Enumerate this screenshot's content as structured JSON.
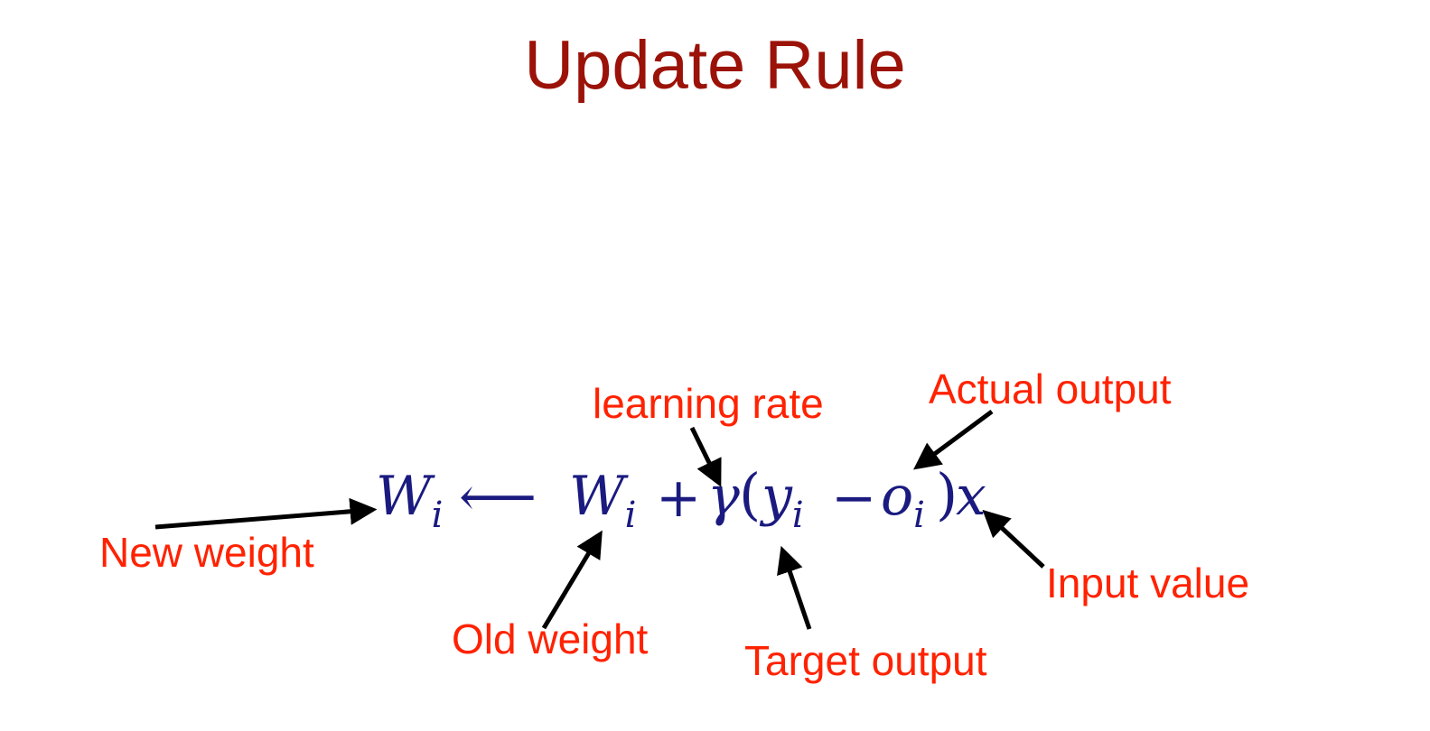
{
  "title": "Update Rule",
  "equation": {
    "lhs_symbol": "W",
    "lhs_sub": "i",
    "arrow": "⟵",
    "rhs_symbol": "W",
    "rhs_sub": "i",
    "plus": "+",
    "gamma": "γ",
    "open_paren": "(",
    "y_symbol": "y",
    "y_sub": "i",
    "minus": "−",
    "o_symbol": "o",
    "o_sub": "i",
    "close_paren": ")",
    "x_symbol": "x"
  },
  "labels": {
    "new_weight": "New weight",
    "old_weight": "Old weight",
    "learning_rate": "learning rate",
    "target_output": "Target output",
    "actual_output": "Actual output",
    "input_value": "Input value"
  },
  "colors": {
    "title": "#9b1208",
    "label": "#ff2200",
    "equation": "#1a1a80",
    "arrow": "#000000"
  }
}
